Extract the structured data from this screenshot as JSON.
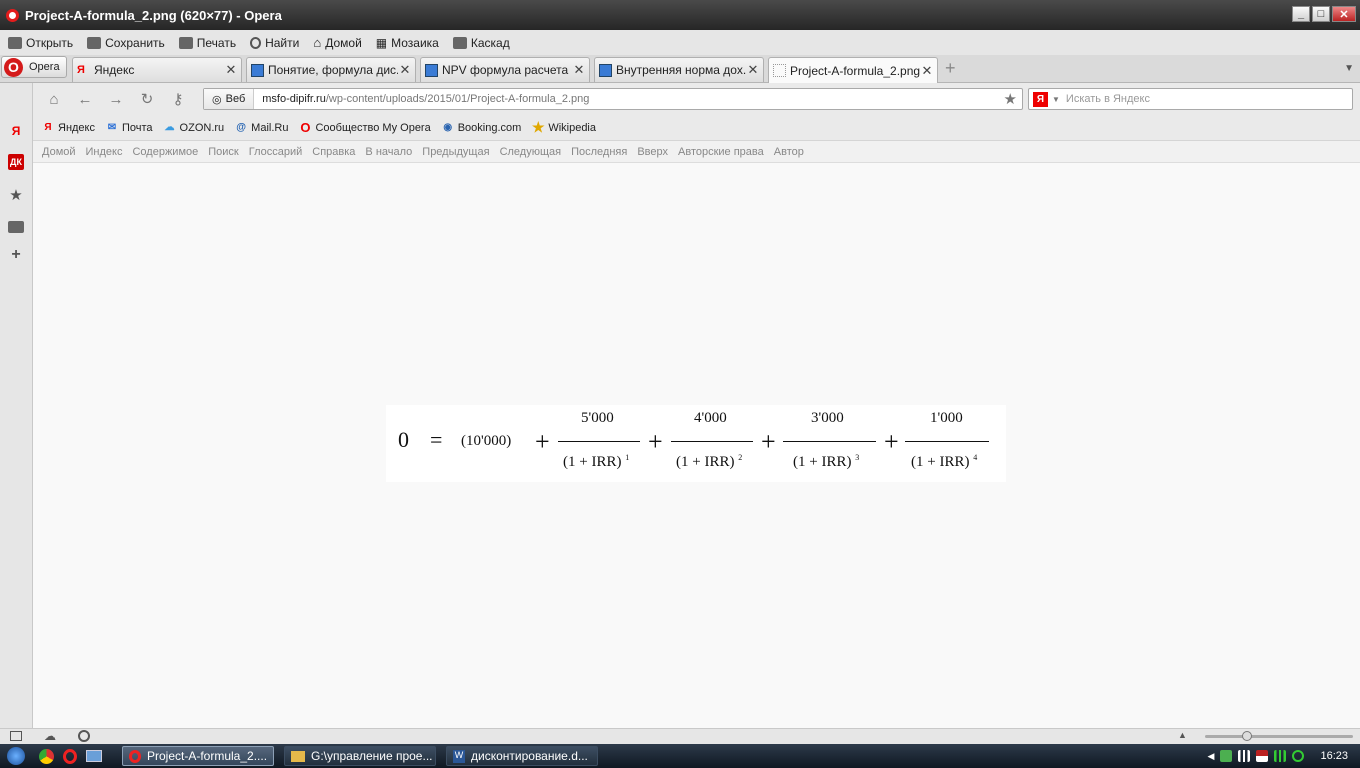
{
  "window": {
    "title": "Project-A-formula_2.png (620×77) - Opera",
    "min": "_",
    "max": "□",
    "close": "✕"
  },
  "menu": [
    "Открыть",
    "Сохранить",
    "Печать",
    "Найти",
    "Домой",
    "Мозаика",
    "Каскад"
  ],
  "opera_button": "Opera",
  "tabs": [
    {
      "title": "Яндекс",
      "favicon": "yandex-icon"
    },
    {
      "title": "Понятие, формула дис...",
      "favicon": "document-icon"
    },
    {
      "title": "NPV формула расчета п...",
      "favicon": "document-icon"
    },
    {
      "title": "Внутренняя норма дох...",
      "favicon": "document-icon"
    },
    {
      "title": "Project-A-formula_2.png...",
      "favicon": "image-icon"
    }
  ],
  "address": {
    "site_label": "Веб",
    "url_host": "msfo-dipifr.ru",
    "url_path": "/wp-content/uploads/2015/01/Project-A-formula_2.png"
  },
  "search": {
    "placeholder": "Искать в Яндекс",
    "engine": "Я"
  },
  "bookmarks": [
    "Яндекс",
    "Почта",
    "OZON.ru",
    "Mail.Ru",
    "Сообщество My Opera",
    "Booking.com",
    "Wikipedia"
  ],
  "site_nav": [
    "Домой",
    "Индекс",
    "Содержимое",
    "Поиск",
    "Глоссарий",
    "Справка",
    "В начало",
    "Предыдущая",
    "Следующая",
    "Последняя",
    "Вверх",
    "Авторские права",
    "Автор"
  ],
  "sidepanel": {
    "y": "Я",
    "dk": "ДК"
  },
  "formula": {
    "lhs": "0",
    "eq": "=",
    "initial": "(10'000)",
    "plus": "+",
    "numerators": [
      "5'000",
      "4'000",
      "3'000",
      "1'000"
    ],
    "denominator": "(1 + IRR)",
    "powers": [
      "1",
      "2",
      "3",
      "4"
    ]
  },
  "taskbar": {
    "buttons": [
      "Project-A-formula_2....",
      "G:\\управление прое...",
      "дисконтирование.d..."
    ],
    "clock": "16:23"
  }
}
